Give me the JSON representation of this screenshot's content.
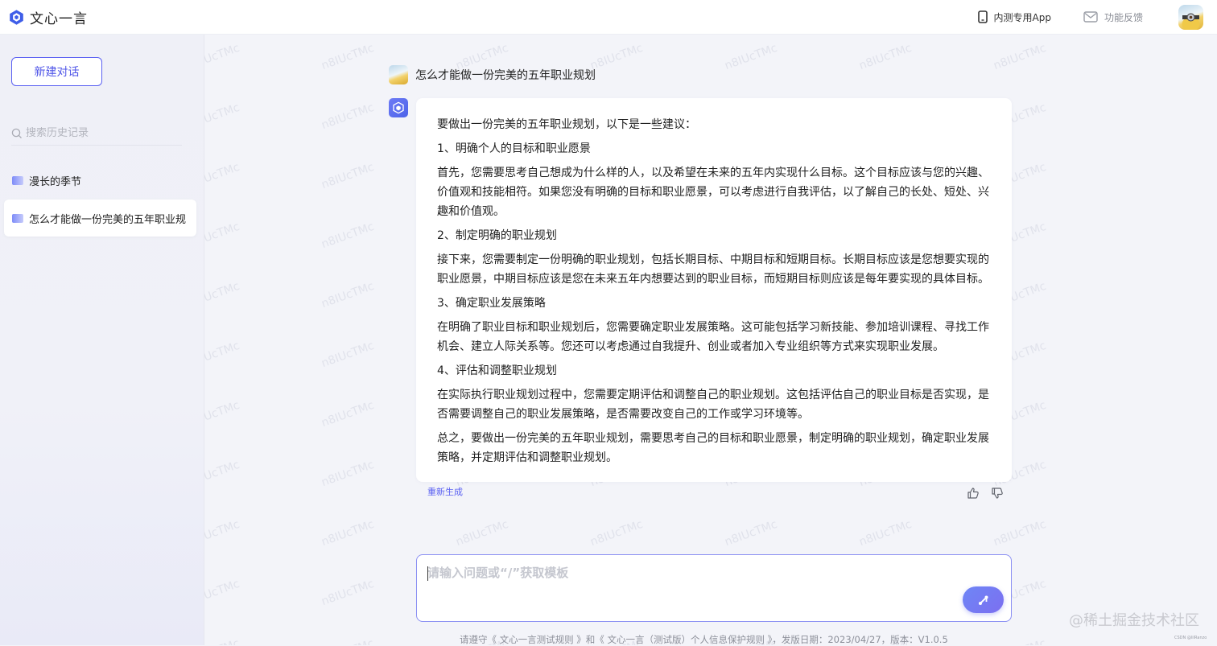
{
  "app": {
    "title": "文心一言"
  },
  "header": {
    "app_link": "内测专用App",
    "feedback_link": "功能反馈"
  },
  "sidebar": {
    "new_chat": "新建对话",
    "search_placeholder": "搜索历史记录",
    "history": [
      {
        "label": "漫长的季节",
        "active": false
      },
      {
        "label": "怎么才能做一份完美的五年职业规",
        "active": true
      }
    ]
  },
  "conversation": {
    "question": "怎么才能做一份完美的五年职业规划",
    "answer": [
      "要做出一份完美的五年职业规划，以下是一些建议：",
      "1、明确个人的目标和职业愿景",
      "首先，您需要思考自己想成为什么样的人，以及希望在未来的五年内实现什么目标。这个目标应该与您的兴趣、价值观和技能相符。如果您没有明确的目标和职业愿景，可以考虑进行自我评估，以了解自己的长处、短处、兴趣和价值观。",
      "2、制定明确的职业规划",
      "接下来，您需要制定一份明确的职业规划，包括长期目标、中期目标和短期目标。长期目标应该是您想要实现的职业愿景，中期目标应该是您在未来五年内想要达到的职业目标，而短期目标则应该是每年要实现的具体目标。",
      "3、确定职业发展策略",
      "在明确了职业目标和职业规划后，您需要确定职业发展策略。这可能包括学习新技能、参加培训课程、寻找工作机会、建立人际关系等。您还可以考虑通过自我提升、创业或者加入专业组织等方式来实现职业发展。",
      "4、评估和调整职业规划",
      "在实际执行职业规划过程中，您需要定期评估和调整自己的职业规划。这包括评估自己的职业目标是否实现，是否需要调整自己的职业发展策略，是否需要改变自己的工作或学习环境等。",
      "总之，要做出一份完美的五年职业规划，需要思考自己的目标和职业愿景，制定明确的职业规划，确定职业发展策略，并定期评估和调整职业规划。"
    ],
    "regenerate": "重新生成"
  },
  "composer": {
    "placeholder": "请输入问题或“/”获取模板"
  },
  "footer": {
    "note": "请遵守《 文心一言测试规则 》和《 文心一言（测试版）个人信息保护规则 》，发版日期：2023/04/27，版本：V1.0.5"
  },
  "overlays": {
    "watermark_text": "n8IUcTMc",
    "corner_mark": "@稀土掘金技术社区",
    "csdn": "CSDN @lilRanzo"
  },
  "colors": {
    "accent": "#5b61f2",
    "send_gradient_start": "#6e86f6",
    "send_gradient_end": "#7c6ff0"
  },
  "icons": {
    "logo": "wenxin-logo-icon",
    "app": "phone-icon",
    "feedback": "mail-icon",
    "search": "search-icon",
    "like": "thumbs-up-icon",
    "dislike": "thumbs-down-icon",
    "send": "send-icon"
  }
}
